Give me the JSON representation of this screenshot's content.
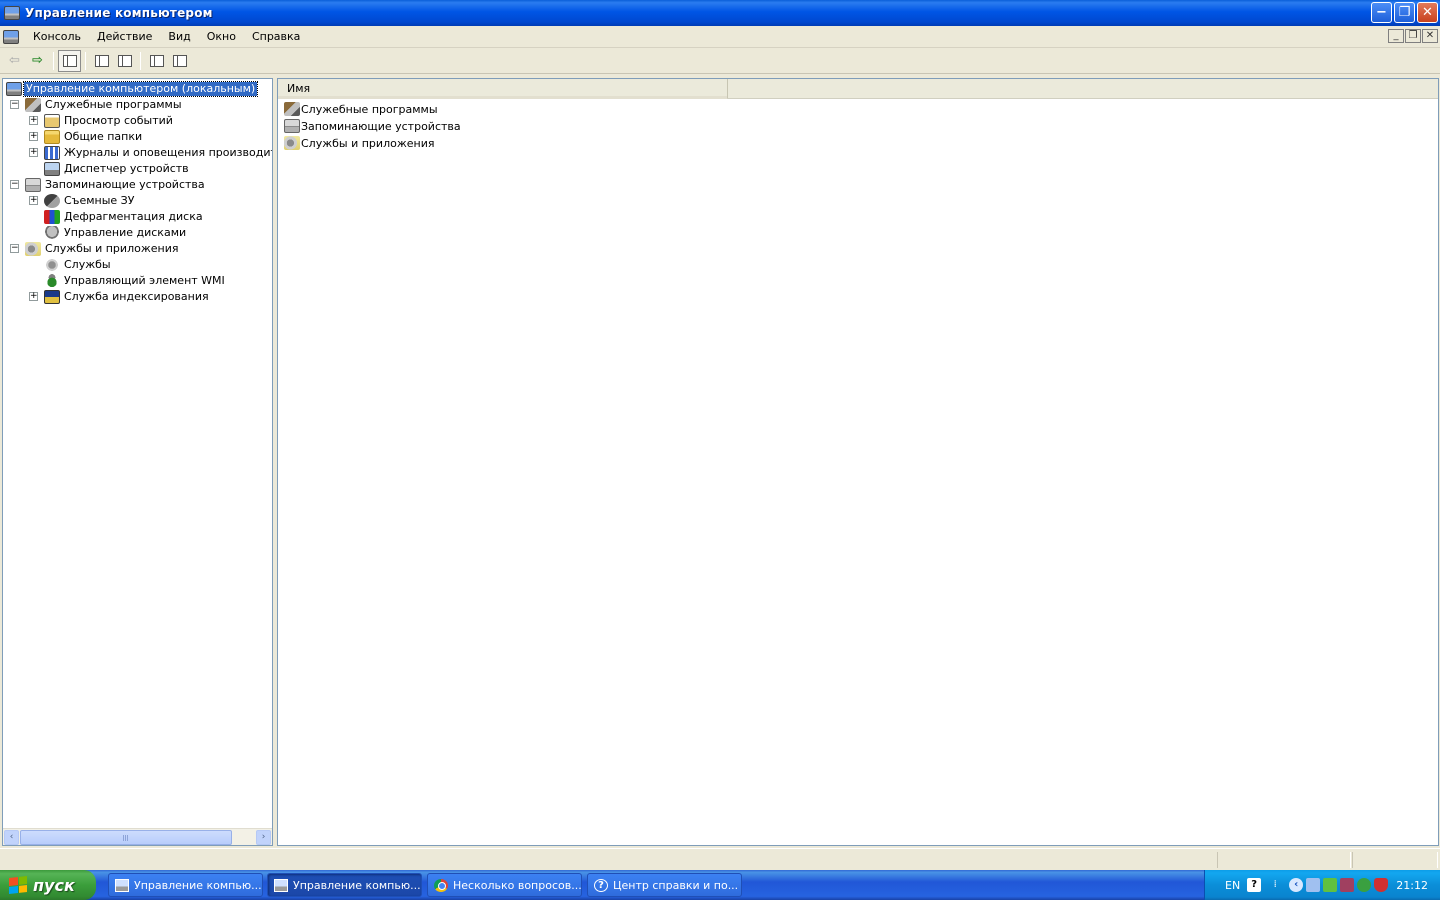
{
  "window": {
    "title": "Управление компьютером",
    "controls": {
      "minimize": "−",
      "restore": "❐",
      "close": "✕"
    }
  },
  "menu": {
    "items": [
      {
        "label": "Консоль",
        "access": "К"
      },
      {
        "label": "Действие",
        "access": "Д"
      },
      {
        "label": "Вид",
        "access": "В"
      },
      {
        "label": "Окно",
        "access": "О"
      },
      {
        "label": "Справка",
        "access": "С"
      }
    ],
    "mdi_controls": {
      "minimize": "_",
      "restore": "❐",
      "close": "✕"
    }
  },
  "toolbar": {
    "back": "⇦",
    "forward": "⇨",
    "icons": [
      "show-hide-tree-icon",
      "properties-icon",
      "export-list-icon",
      "help-icon",
      "show-hide-action-pane-icon"
    ]
  },
  "tree": {
    "root": "Управление компьютером (локальным)",
    "nodes": [
      {
        "label": "Служебные программы",
        "icon": "tools-icon",
        "level": 1,
        "expander": "−"
      },
      {
        "label": "Просмотр событий",
        "icon": "event-viewer-icon",
        "level": 2,
        "expander": "+"
      },
      {
        "label": "Общие папки",
        "icon": "shared-folders-icon",
        "level": 2,
        "expander": "+"
      },
      {
        "label": "Журналы и оповещения производительн",
        "icon": "performance-logs-icon",
        "level": 2,
        "expander": "+"
      },
      {
        "label": "Диспетчер устройств",
        "icon": "device-manager-icon",
        "level": 2,
        "expander": ""
      },
      {
        "label": "Запоминающие устройства",
        "icon": "storage-icon",
        "level": 1,
        "expander": "−"
      },
      {
        "label": "Съемные ЗУ",
        "icon": "removable-storage-icon",
        "level": 2,
        "expander": "+"
      },
      {
        "label": "Дефрагментация диска",
        "icon": "defrag-icon",
        "level": 2,
        "expander": ""
      },
      {
        "label": "Управление дисками",
        "icon": "disk-management-icon",
        "level": 2,
        "expander": ""
      },
      {
        "label": "Службы и приложения",
        "icon": "services-apps-icon",
        "level": 1,
        "expander": "−"
      },
      {
        "label": "Службы",
        "icon": "services-icon",
        "level": 2,
        "expander": ""
      },
      {
        "label": "Управляющий элемент WMI",
        "icon": "wmi-icon",
        "level": 2,
        "expander": ""
      },
      {
        "label": "Служба индексирования",
        "icon": "indexing-service-icon",
        "level": 2,
        "expander": "+"
      }
    ],
    "scroll_left": "‹",
    "scroll_right": "›"
  },
  "list": {
    "column_header": "Имя",
    "items": [
      {
        "label": "Служебные программы",
        "icon": "tools-icon"
      },
      {
        "label": "Запоминающие устройства",
        "icon": "storage-icon"
      },
      {
        "label": "Службы и приложения",
        "icon": "services-apps-icon"
      }
    ]
  },
  "taskbar": {
    "start_label": "пуск",
    "buttons": [
      {
        "label": "Управление компью...",
        "icon": "computer-management-icon",
        "active": false
      },
      {
        "label": "Управление компью...",
        "icon": "computer-management-icon",
        "active": true
      },
      {
        "label": "Несколько вопросов...",
        "icon": "chrome-icon",
        "active": false
      },
      {
        "label": "Центр справки и по...",
        "icon": "help-center-icon",
        "active": false
      }
    ],
    "tray": {
      "language": "EN",
      "clock": "21:12"
    }
  },
  "colors": {
    "titlebar": "#0055e5",
    "selection": "#316ac5",
    "taskbar": "#2157d7",
    "start": "#3b9e3b",
    "tray": "#0b8ed8"
  }
}
